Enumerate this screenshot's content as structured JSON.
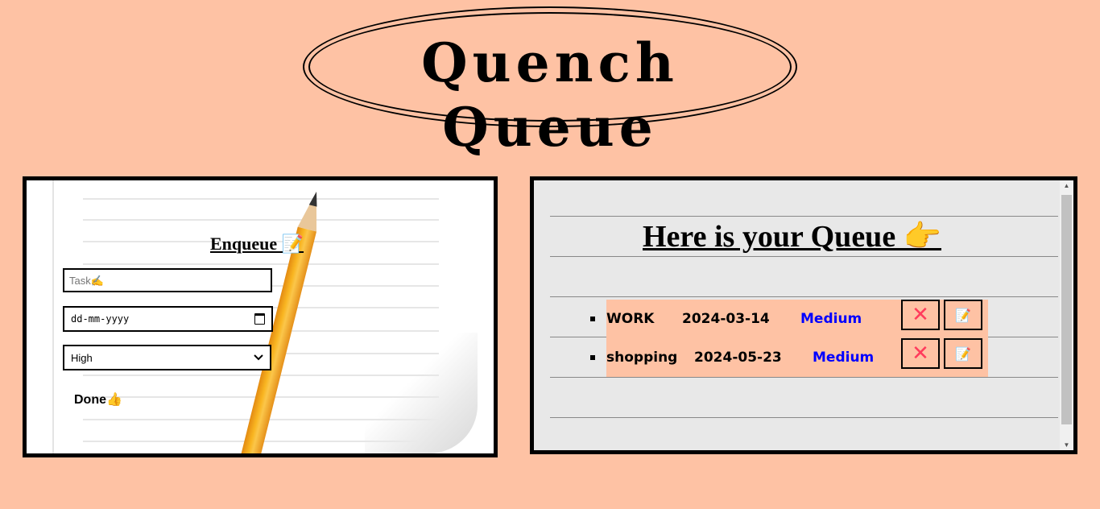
{
  "header": {
    "title": "Quench Queue"
  },
  "enqueue_panel": {
    "heading": "Enqueue 📝",
    "task_placeholder": "Task✍️",
    "date_placeholder": "dd-mm-yyyy",
    "priority_selected": "High",
    "done_label": "Done👍"
  },
  "queue_panel": {
    "heading": "Here is your Queue 👉",
    "items": [
      {
        "task": "WORK",
        "date": "2024-03-14",
        "priority": "Medium"
      },
      {
        "task": "shopping",
        "date": "2024-05-23",
        "priority": "Medium"
      }
    ],
    "delete_symbol": "✕",
    "edit_symbol": "📝"
  },
  "colors": {
    "background": "#fec2a4",
    "priority_text": "#0000ff",
    "delete_icon": "#ff3b5c"
  }
}
